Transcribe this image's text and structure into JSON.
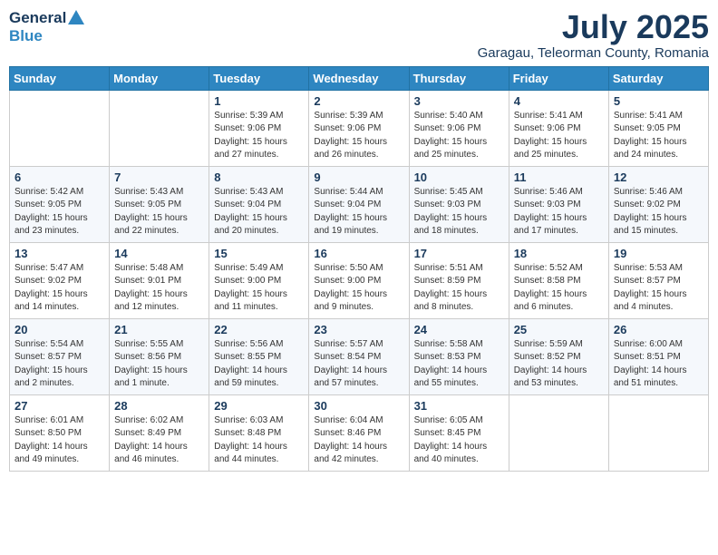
{
  "header": {
    "logo_general": "General",
    "logo_blue": "Blue",
    "month_year": "July 2025",
    "location": "Garagau, Teleorman County, Romania"
  },
  "weekdays": [
    "Sunday",
    "Monday",
    "Tuesday",
    "Wednesday",
    "Thursday",
    "Friday",
    "Saturday"
  ],
  "weeks": [
    [
      {
        "day": "",
        "info": ""
      },
      {
        "day": "",
        "info": ""
      },
      {
        "day": "1",
        "info": "Sunrise: 5:39 AM\nSunset: 9:06 PM\nDaylight: 15 hours and 27 minutes."
      },
      {
        "day": "2",
        "info": "Sunrise: 5:39 AM\nSunset: 9:06 PM\nDaylight: 15 hours and 26 minutes."
      },
      {
        "day": "3",
        "info": "Sunrise: 5:40 AM\nSunset: 9:06 PM\nDaylight: 15 hours and 25 minutes."
      },
      {
        "day": "4",
        "info": "Sunrise: 5:41 AM\nSunset: 9:06 PM\nDaylight: 15 hours and 25 minutes."
      },
      {
        "day": "5",
        "info": "Sunrise: 5:41 AM\nSunset: 9:05 PM\nDaylight: 15 hours and 24 minutes."
      }
    ],
    [
      {
        "day": "6",
        "info": "Sunrise: 5:42 AM\nSunset: 9:05 PM\nDaylight: 15 hours and 23 minutes."
      },
      {
        "day": "7",
        "info": "Sunrise: 5:43 AM\nSunset: 9:05 PM\nDaylight: 15 hours and 22 minutes."
      },
      {
        "day": "8",
        "info": "Sunrise: 5:43 AM\nSunset: 9:04 PM\nDaylight: 15 hours and 20 minutes."
      },
      {
        "day": "9",
        "info": "Sunrise: 5:44 AM\nSunset: 9:04 PM\nDaylight: 15 hours and 19 minutes."
      },
      {
        "day": "10",
        "info": "Sunrise: 5:45 AM\nSunset: 9:03 PM\nDaylight: 15 hours and 18 minutes."
      },
      {
        "day": "11",
        "info": "Sunrise: 5:46 AM\nSunset: 9:03 PM\nDaylight: 15 hours and 17 minutes."
      },
      {
        "day": "12",
        "info": "Sunrise: 5:46 AM\nSunset: 9:02 PM\nDaylight: 15 hours and 15 minutes."
      }
    ],
    [
      {
        "day": "13",
        "info": "Sunrise: 5:47 AM\nSunset: 9:02 PM\nDaylight: 15 hours and 14 minutes."
      },
      {
        "day": "14",
        "info": "Sunrise: 5:48 AM\nSunset: 9:01 PM\nDaylight: 15 hours and 12 minutes."
      },
      {
        "day": "15",
        "info": "Sunrise: 5:49 AM\nSunset: 9:00 PM\nDaylight: 15 hours and 11 minutes."
      },
      {
        "day": "16",
        "info": "Sunrise: 5:50 AM\nSunset: 9:00 PM\nDaylight: 15 hours and 9 minutes."
      },
      {
        "day": "17",
        "info": "Sunrise: 5:51 AM\nSunset: 8:59 PM\nDaylight: 15 hours and 8 minutes."
      },
      {
        "day": "18",
        "info": "Sunrise: 5:52 AM\nSunset: 8:58 PM\nDaylight: 15 hours and 6 minutes."
      },
      {
        "day": "19",
        "info": "Sunrise: 5:53 AM\nSunset: 8:57 PM\nDaylight: 15 hours and 4 minutes."
      }
    ],
    [
      {
        "day": "20",
        "info": "Sunrise: 5:54 AM\nSunset: 8:57 PM\nDaylight: 15 hours and 2 minutes."
      },
      {
        "day": "21",
        "info": "Sunrise: 5:55 AM\nSunset: 8:56 PM\nDaylight: 15 hours and 1 minute."
      },
      {
        "day": "22",
        "info": "Sunrise: 5:56 AM\nSunset: 8:55 PM\nDaylight: 14 hours and 59 minutes."
      },
      {
        "day": "23",
        "info": "Sunrise: 5:57 AM\nSunset: 8:54 PM\nDaylight: 14 hours and 57 minutes."
      },
      {
        "day": "24",
        "info": "Sunrise: 5:58 AM\nSunset: 8:53 PM\nDaylight: 14 hours and 55 minutes."
      },
      {
        "day": "25",
        "info": "Sunrise: 5:59 AM\nSunset: 8:52 PM\nDaylight: 14 hours and 53 minutes."
      },
      {
        "day": "26",
        "info": "Sunrise: 6:00 AM\nSunset: 8:51 PM\nDaylight: 14 hours and 51 minutes."
      }
    ],
    [
      {
        "day": "27",
        "info": "Sunrise: 6:01 AM\nSunset: 8:50 PM\nDaylight: 14 hours and 49 minutes."
      },
      {
        "day": "28",
        "info": "Sunrise: 6:02 AM\nSunset: 8:49 PM\nDaylight: 14 hours and 46 minutes."
      },
      {
        "day": "29",
        "info": "Sunrise: 6:03 AM\nSunset: 8:48 PM\nDaylight: 14 hours and 44 minutes."
      },
      {
        "day": "30",
        "info": "Sunrise: 6:04 AM\nSunset: 8:46 PM\nDaylight: 14 hours and 42 minutes."
      },
      {
        "day": "31",
        "info": "Sunrise: 6:05 AM\nSunset: 8:45 PM\nDaylight: 14 hours and 40 minutes."
      },
      {
        "day": "",
        "info": ""
      },
      {
        "day": "",
        "info": ""
      }
    ]
  ]
}
